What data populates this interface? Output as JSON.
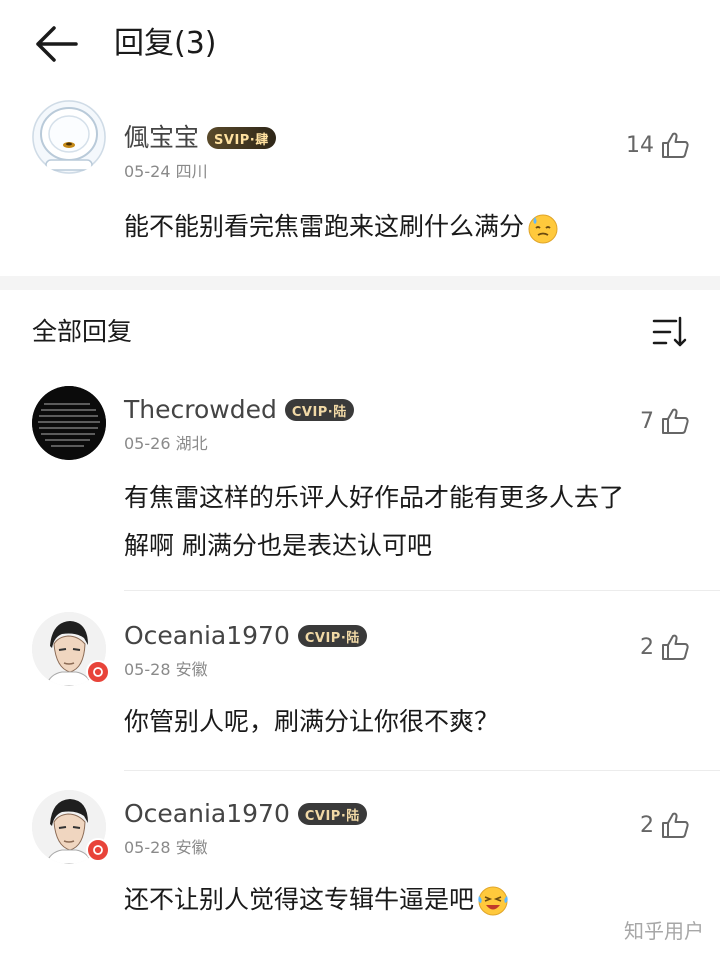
{
  "header": {
    "title": "回复(3)"
  },
  "top_comment": {
    "user": "偑宝宝",
    "vip": "SVIP·肆",
    "date": "05-24",
    "location": "四川",
    "likes": "14",
    "text": "能不能别看完焦雷跑来这刷什么满分",
    "emoji": "sweat-smile-emoji"
  },
  "section": {
    "title": "全部回复"
  },
  "replies": [
    {
      "user": "Thecrowded",
      "vip": "CVIP·陆",
      "date": "05-26",
      "location": "湖北",
      "likes": "7",
      "lines": [
        "有焦雷这样的乐评人好作品才能有更多人去了",
        "解啊 刷满分也是表达认可吧"
      ]
    },
    {
      "user": "Oceania1970",
      "vip": "CVIP·陆",
      "date": "05-28",
      "location": "安徽",
      "likes": "2",
      "lines": [
        "你管别人呢，刷满分让你很不爽？"
      ]
    },
    {
      "user": "Oceania1970",
      "vip": "CVIP·陆",
      "date": "05-28",
      "location": "安徽",
      "likes": "2",
      "lines": [
        "还不让别人觉得这专辑牛逼是吧"
      ],
      "emoji": "laugh-cry-emoji"
    }
  ],
  "watermark": "知乎用户",
  "colors": {
    "vip_badge": "#3a3a3a",
    "vip_text": "#f1d9a6",
    "divider": "#ececec",
    "section_gap": "#f4f4f4"
  }
}
